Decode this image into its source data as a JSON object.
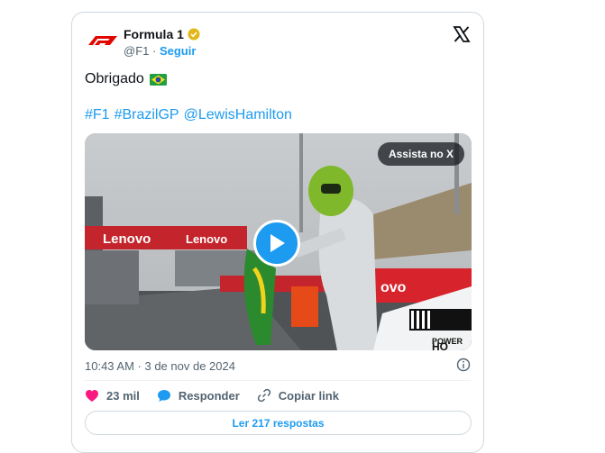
{
  "tweet": {
    "author_name": "Formula 1",
    "handle": "@F1",
    "separator": "·",
    "follow_label": "Seguir",
    "text": "Obrigado",
    "hashtags": [
      "#F1",
      "#BrazilGP",
      "@LewisHamilton"
    ],
    "watch_label": "Assista no X",
    "timestamp": "10:43 AM · 3 de nov de 2024",
    "likes": "23 mil",
    "reply_label": "Responder",
    "copy_label": "Copiar link",
    "read_replies": "Ler 217 respostas",
    "media_texts": [
      "Lenovo",
      "Lenovo",
      "ovo",
      "POWER",
      "HO"
    ]
  },
  "icons": {
    "logo": "f1-logo",
    "verified": "verified-badge-icon",
    "close": "x-logo-icon",
    "play": "play-icon",
    "info": "info-icon",
    "heart": "heart-icon",
    "reply": "reply-bubble-icon",
    "link": "link-icon"
  },
  "colors": {
    "accent": "#1d9bf0",
    "heart": "#f91880",
    "f1_red": "#e10600",
    "verified": "#e2b719"
  }
}
